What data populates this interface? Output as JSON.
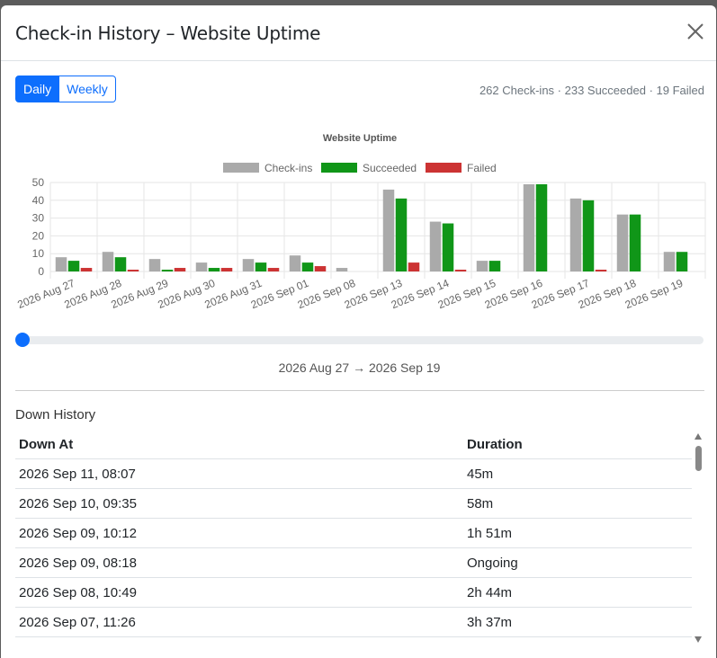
{
  "modal": {
    "title": "Check-in History – Website Uptime",
    "close_icon": "close-icon"
  },
  "toggle": {
    "daily_label": "Daily",
    "weekly_label": "Weekly",
    "selected": "Daily"
  },
  "summary": "262 Check-ins · 233 Succeeded · 19 Failed",
  "colors": {
    "checkins": "#aaaaaa",
    "succeeded": "#109618",
    "failed": "#dc3912",
    "accent": "#0d6efd"
  },
  "chart_data": {
    "type": "bar",
    "title": "Website Uptime",
    "categories": [
      "2026 Aug 27",
      "2026 Aug 28",
      "2026 Aug 29",
      "2026 Aug 30",
      "2026 Aug 31",
      "2026 Sep 01",
      "2026 Sep 08",
      "2026 Sep 13",
      "2026 Sep 14",
      "2026 Sep 15",
      "2026 Sep 16",
      "2026 Sep 17",
      "2026 Sep 18",
      "2026 Sep 19"
    ],
    "series": [
      {
        "name": "Check-ins",
        "color": "#aaaaaa",
        "values": [
          8,
          11,
          7,
          5,
          7,
          9,
          2,
          46,
          28,
          6,
          49,
          41,
          32,
          11
        ]
      },
      {
        "name": "Succeeded",
        "color": "#109618",
        "values": [
          6,
          8,
          1,
          2,
          5,
          5,
          0,
          41,
          27,
          6,
          49,
          40,
          32,
          11
        ]
      },
      {
        "name": "Failed",
        "color": "#cc3333",
        "values": [
          2,
          1,
          2,
          2,
          2,
          3,
          0,
          5,
          1,
          0,
          0,
          1,
          0,
          0
        ]
      }
    ],
    "ylim": [
      0,
      50
    ],
    "yticks": [
      0,
      10,
      20,
      30,
      40,
      50
    ],
    "legend": "top",
    "grid": true,
    "xlabel": "",
    "ylabel": ""
  },
  "range": {
    "label": "2026 Aug 27 → 2026 Sep 19",
    "position": 0
  },
  "down_history": {
    "title": "Down History",
    "headers": [
      "Down At",
      "Duration"
    ],
    "rows": [
      [
        "2026 Sep 11, 08:07",
        "45m"
      ],
      [
        "2026 Sep 10, 09:35",
        "58m"
      ],
      [
        "2026 Sep 09, 10:12",
        "1h 51m"
      ],
      [
        "2026 Sep 09, 08:18",
        "Ongoing"
      ],
      [
        "2026 Sep 08, 10:49",
        "2h 44m"
      ],
      [
        "2026 Sep 07, 11:26",
        "3h 37m"
      ],
      [
        "",
        ""
      ]
    ]
  }
}
